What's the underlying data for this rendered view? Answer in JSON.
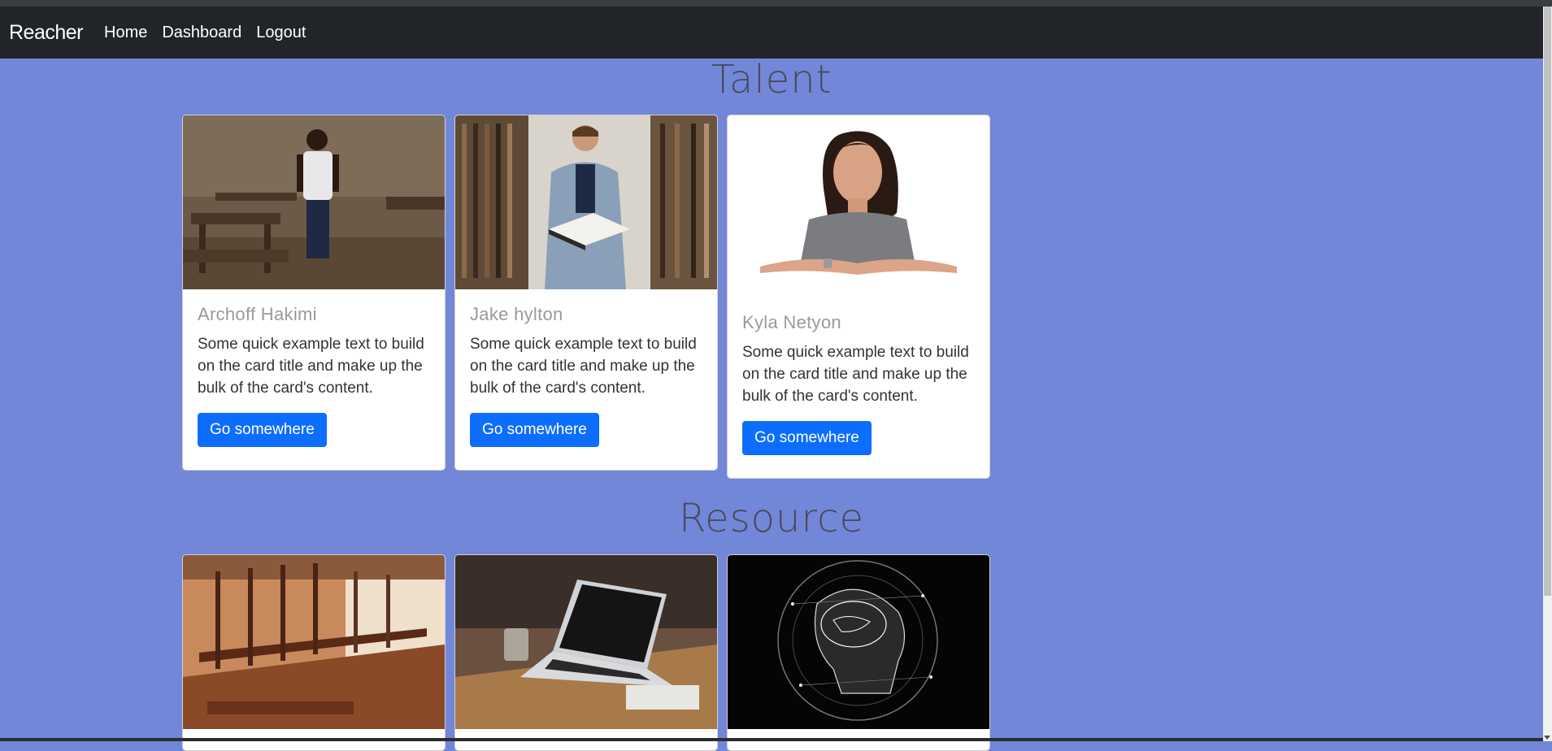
{
  "navbar": {
    "brand": "Reacher",
    "links": [
      "Home",
      "Dashboard",
      "Logout"
    ]
  },
  "talent": {
    "title": "Talent",
    "cards": [
      {
        "name": "Archoff Hakimi",
        "text": "Some quick example text to build on the card title and make up the bulk of the card's content.",
        "button": "Go somewhere"
      },
      {
        "name": "Jake hylton",
        "text": "Some quick example text to build on the card title and make up the bulk of the card's content.",
        "button": "Go somewhere"
      },
      {
        "name": "Kyla Netyon",
        "text": "Some quick example text to build on the card title and make up the bulk of the card's content.",
        "button": "Go somewhere"
      }
    ]
  },
  "resource": {
    "title": "Resource"
  },
  "colors": {
    "background": "#7287d8",
    "navbar": "#212529",
    "button": "#0d6efd"
  }
}
